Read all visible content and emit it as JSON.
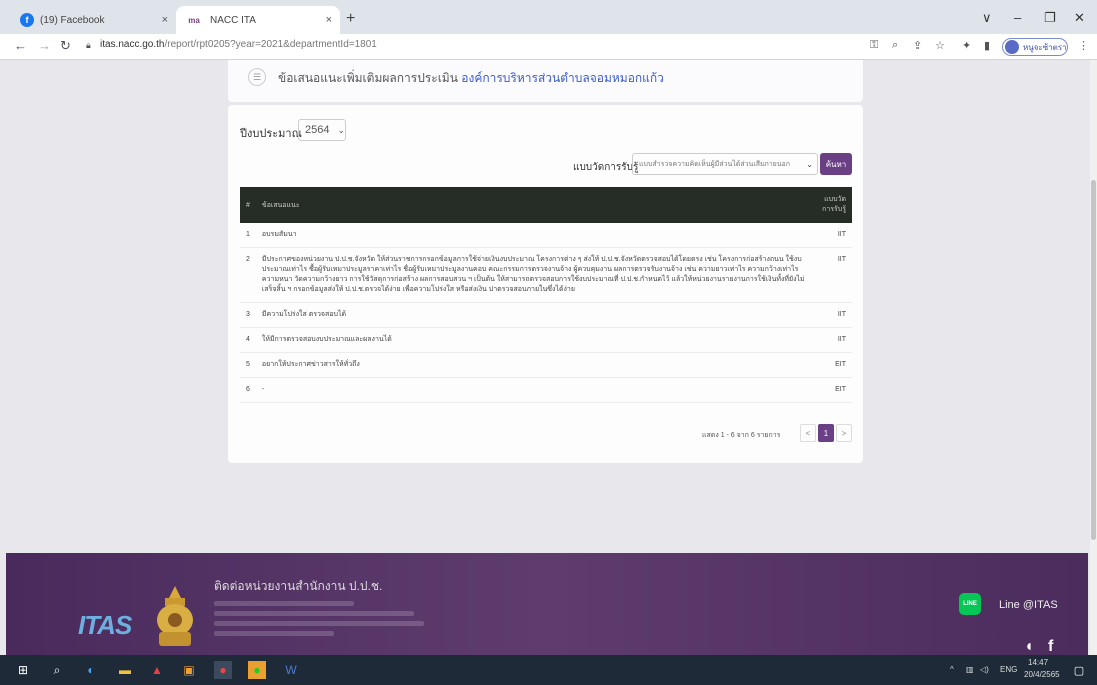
{
  "browser": {
    "tabs": [
      {
        "title": "(19) Facebook",
        "favicon": "facebook-icon",
        "close": "×"
      },
      {
        "title": "NACC ITA",
        "favicon": "nacc-icon",
        "favicon_text": "ma",
        "close": "×"
      }
    ],
    "new_tab": "+",
    "window_controls": [
      "∨",
      "–",
      "❐",
      "✕"
    ],
    "url_host": "itas.nacc.go.th",
    "url_path": "/report/rpt0205?year=2021&departmentId=1801",
    "profile_label": "หนูจะซ้าตรา"
  },
  "header": {
    "title": "ข้อเสนอแนะเพิ่มเติมผลการประเมิน",
    "org": "องค์การบริหารส่วนตำบลจอมหมอกแก้ว"
  },
  "filters": {
    "year_label": "ปีงบประมาณ",
    "year_value": "2564",
    "form_label": "แบบวัดการรับรู้",
    "form_value": "แบบสำรวจความคิดเห็นผู้มีส่วนได้ส่วนเสียภายนอก",
    "search_label": "ค้นหา"
  },
  "table": {
    "headers": {
      "num": "#",
      "item": "ข้อเสนอแนะ",
      "type": "แบบวัด การรับรู้"
    },
    "rows": [
      {
        "num": "1",
        "text": "อบรมสัมนา",
        "type": "IIT"
      },
      {
        "num": "2",
        "text": "มีประกาศของหน่วยงาน ป.ป.ช.จังหวัด ให้ส่วนราชการกรอกข้อมูลการใช้จ่ายเงินงบประมาณ โครงการต่าง ๆ ส่งให้ ป.ป.ช.จังหวัดตรวจสอบได้โดยตรง เช่น โครงการก่อสร้างถนน ใช้งบประมาณเท่าไร ซื้อผู้รับเหมาประมูลราคาเท่าไร ชื่อผู้รับเหมาประมูลงานคอบ คณะกรรมการตรวจงานจ้าง ผู้ควบคุมงาน ผลการตรวจรับงานจ้าง เช่น ความยาวเท่าไร ความกว้างเท่าไร ความหนา วัดความกว้างยาว การใช้วัสดุการก่อสร้าง ผลการสอบสวน ฯ เป็นต้น ให้สามารถตรวจสอบการใช้งบประมาณที่ ป.ป.ช.กำหนดไว้ แล้วให้หน่วยงานรายงานการใช้เงินทั้งที่ยังไม่เสร็จสิ้น ฯ กรอกข้อมูลส่งให้ ป.ป.ช.ตรวจได้ง่าย เพื่อความโปร่งใส หรือส่งเงิน ปาตรวจสอบภายในซึ่งได้ง่าย",
        "type": "IIT"
      },
      {
        "num": "3",
        "text": "มีความโปร่งใส ตรวจสอบได้",
        "type": "IIT"
      },
      {
        "num": "4",
        "text": "ให้มีการตรวจสอบงบประมาณและผลงานได้",
        "type": "IIT"
      },
      {
        "num": "5",
        "text": "อยากให้ประกาศข่าวสารให้ทั่วถึง",
        "type": "EIT"
      },
      {
        "num": "6",
        "text": "-",
        "type": "EIT"
      }
    ]
  },
  "pagination": {
    "info": "แสดง 1 - 6 จาก 6 รายการ",
    "prev": "<",
    "current": "1",
    "next": ">"
  },
  "footer": {
    "logo_text": "ITAS",
    "contact_title": "ติดต่อหน่วยงานสำนักงาน ป.ป.ช.",
    "line_icon_text": "LINE",
    "line_label": "Line @ITAS"
  },
  "taskbar": {
    "time": "14:47",
    "date": "20/4/2565",
    "lang": "ENG"
  }
}
